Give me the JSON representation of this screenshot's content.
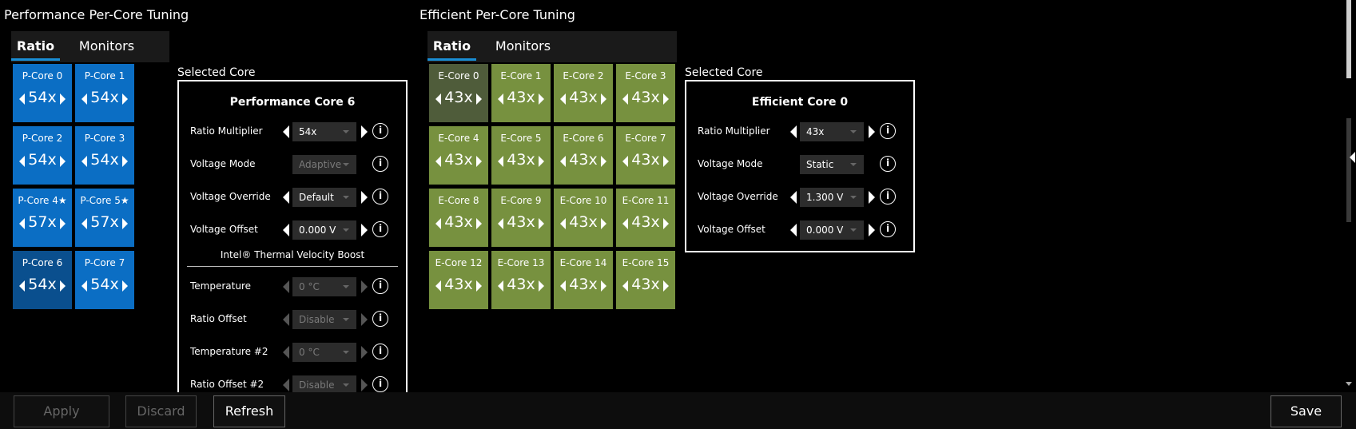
{
  "performance": {
    "title": "Performance Per-Core Tuning",
    "tabs": [
      {
        "label": "Ratio"
      },
      {
        "label": "Monitors"
      }
    ],
    "selected_label": "Selected Core",
    "cores": [
      {
        "name": "P-Core 0",
        "ratio": "54x"
      },
      {
        "name": "P-Core 1",
        "ratio": "54x"
      },
      {
        "name": "P-Core 2",
        "ratio": "54x"
      },
      {
        "name": "P-Core 3",
        "ratio": "54x"
      },
      {
        "name": "P-Core 4★",
        "ratio": "57x"
      },
      {
        "name": "P-Core 5★",
        "ratio": "57x"
      },
      {
        "name": "P-Core 6",
        "ratio": "54x"
      },
      {
        "name": "P-Core 7",
        "ratio": "54x"
      }
    ],
    "panel": {
      "title": "Performance Core 6",
      "ratio_multiplier": {
        "label": "Ratio Multiplier",
        "value": "54x"
      },
      "voltage_mode": {
        "label": "Voltage Mode",
        "value": "Adaptive"
      },
      "voltage_override": {
        "label": "Voltage Override",
        "value": "Default"
      },
      "voltage_offset": {
        "label": "Voltage Offset",
        "value": "0.000 V"
      },
      "tvb_title": "Intel® Thermal Velocity Boost",
      "temperature": {
        "label": "Temperature",
        "value": "0 °C"
      },
      "ratio_offset": {
        "label": "Ratio Offset",
        "value": "Disable"
      },
      "temperature2": {
        "label": "Temperature #2",
        "value": "0 °C"
      },
      "ratio_offset2": {
        "label": "Ratio Offset #2",
        "value": "Disable"
      }
    }
  },
  "efficient": {
    "title": "Efficient Per-Core Tuning",
    "tabs": [
      {
        "label": "Ratio"
      },
      {
        "label": "Monitors"
      }
    ],
    "selected_label": "Selected Core",
    "cores": [
      {
        "name": "E-Core 0",
        "ratio": "43x"
      },
      {
        "name": "E-Core 1",
        "ratio": "43x"
      },
      {
        "name": "E-Core 2",
        "ratio": "43x"
      },
      {
        "name": "E-Core 3",
        "ratio": "43x"
      },
      {
        "name": "E-Core 4",
        "ratio": "43x"
      },
      {
        "name": "E-Core 5",
        "ratio": "43x"
      },
      {
        "name": "E-Core 6",
        "ratio": "43x"
      },
      {
        "name": "E-Core 7",
        "ratio": "43x"
      },
      {
        "name": "E-Core 8",
        "ratio": "43x"
      },
      {
        "name": "E-Core 9",
        "ratio": "43x"
      },
      {
        "name": "E-Core 10",
        "ratio": "43x"
      },
      {
        "name": "E-Core 11",
        "ratio": "43x"
      },
      {
        "name": "E-Core 12",
        "ratio": "43x"
      },
      {
        "name": "E-Core 13",
        "ratio": "43x"
      },
      {
        "name": "E-Core 14",
        "ratio": "43x"
      },
      {
        "name": "E-Core 15",
        "ratio": "43x"
      }
    ],
    "panel": {
      "title": "Efficient Core 0",
      "ratio_multiplier": {
        "label": "Ratio Multiplier",
        "value": "43x"
      },
      "voltage_mode": {
        "label": "Voltage Mode",
        "value": "Static"
      },
      "voltage_override": {
        "label": "Voltage Override",
        "value": "1.300 V"
      },
      "voltage_offset": {
        "label": "Voltage Offset",
        "value": "0.000 V"
      }
    }
  },
  "buttons": {
    "apply": "Apply",
    "discard": "Discard",
    "refresh": "Refresh",
    "save": "Save"
  },
  "icons": {
    "info": "i"
  },
  "colors": {
    "p_core": "#0b6ec4",
    "p_core_selected": "#0a4f8e",
    "e_core": "#77913f",
    "e_core_selected": "#4f5c3a",
    "tab_accent": "#1a8fd6"
  }
}
